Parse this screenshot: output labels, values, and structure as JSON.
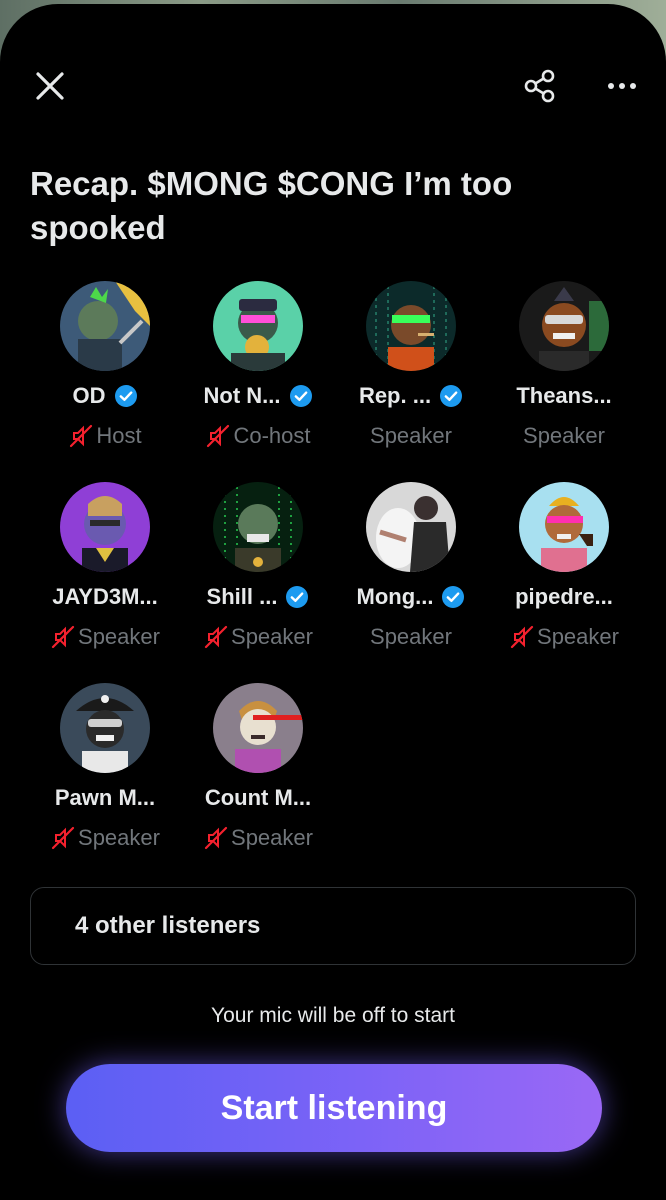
{
  "header": {
    "close_icon": "close-icon",
    "share_icon": "share-icon",
    "more_icon": "more-icon"
  },
  "space": {
    "title": "Recap. $MONG $CONG  I’m too spooked"
  },
  "colors": {
    "verified": "#1d9bf0",
    "muted": "#f4212e",
    "role_text": "#71767b",
    "button_start": "#5b5ff4",
    "button_end": "#9a68f5"
  },
  "speakers": [
    {
      "name": "OD",
      "role": "Host",
      "verified": true,
      "muted": true,
      "avatar_bg": "#3d5a78"
    },
    {
      "name": "Not N...",
      "role": "Co-host",
      "verified": true,
      "muted": true,
      "avatar_bg": "#5ad1a8"
    },
    {
      "name": "Rep. ...",
      "role": "Speaker",
      "verified": true,
      "muted": false,
      "avatar_bg": "#0c2a2a"
    },
    {
      "name": "Theans...",
      "role": "Speaker",
      "verified": false,
      "muted": false,
      "avatar_bg": "#1a1a1a"
    },
    {
      "name": "JAYD3M...",
      "role": "Speaker",
      "verified": false,
      "muted": true,
      "avatar_bg": "#8f3fd6"
    },
    {
      "name": "Shill ...",
      "role": "Speaker",
      "verified": true,
      "muted": true,
      "avatar_bg": "#062010"
    },
    {
      "name": "Mong...",
      "role": "Speaker",
      "verified": true,
      "muted": false,
      "avatar_bg": "#d8d8d8"
    },
    {
      "name": "pipedre...",
      "role": "Speaker",
      "verified": false,
      "muted": true,
      "avatar_bg": "#a8e0f0"
    },
    {
      "name": "Pawn M...",
      "role": "Speaker",
      "verified": false,
      "muted": true,
      "avatar_bg": "#3a4a5a"
    },
    {
      "name": "Count M...",
      "role": "Speaker",
      "verified": false,
      "muted": true,
      "avatar_bg": "#8a7f8c"
    }
  ],
  "listeners": {
    "label": "4 other listeners"
  },
  "footer": {
    "mic_note": "Your mic will be off to start",
    "start_label": "Start listening"
  }
}
